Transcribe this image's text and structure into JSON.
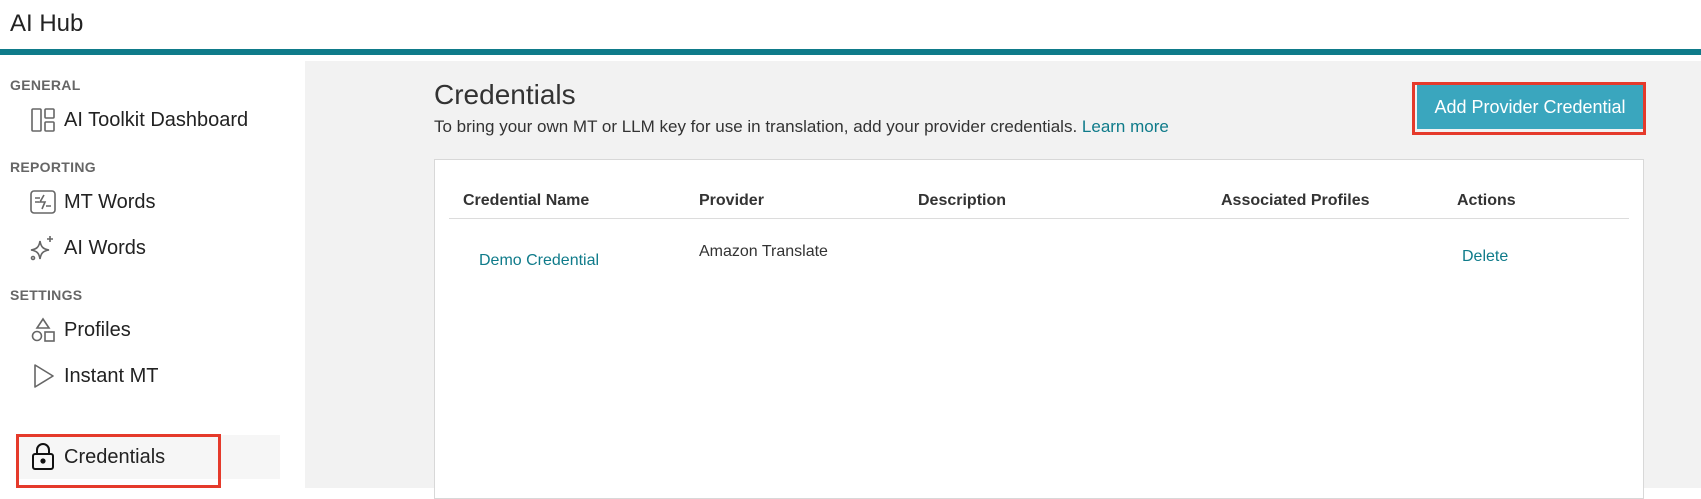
{
  "app": {
    "title": "AI Hub"
  },
  "sidebar": {
    "sections": [
      {
        "label": "GENERAL"
      },
      {
        "label": "REPORTING"
      },
      {
        "label": "SETTINGS"
      }
    ],
    "items": [
      {
        "label": "AI Toolkit Dashboard",
        "icon": "dashboard-icon"
      },
      {
        "label": "MT Words",
        "icon": "mt-words-icon"
      },
      {
        "label": "AI Words",
        "icon": "sparkle-icon"
      },
      {
        "label": "Profiles",
        "icon": "shapes-icon"
      },
      {
        "label": "Instant MT",
        "icon": "play-icon"
      },
      {
        "label": "Credentials",
        "icon": "lock-icon",
        "active": true
      }
    ]
  },
  "page": {
    "title": "Credentials",
    "description": "To bring your own MT or LLM key for use in translation, add your provider credentials.",
    "learn_more": "Learn more",
    "add_button": "Add Provider Credential"
  },
  "table": {
    "columns": [
      "Credential Name",
      "Provider",
      "Description",
      "Associated Profiles",
      "Actions"
    ],
    "rows": [
      {
        "name": "Demo Credential",
        "provider": "Amazon Translate",
        "description": "",
        "profiles": "",
        "action": "Delete"
      }
    ]
  },
  "colors": {
    "accent": "#0f7b8a",
    "button": "#3aa6be",
    "highlight": "#e53a2b"
  }
}
